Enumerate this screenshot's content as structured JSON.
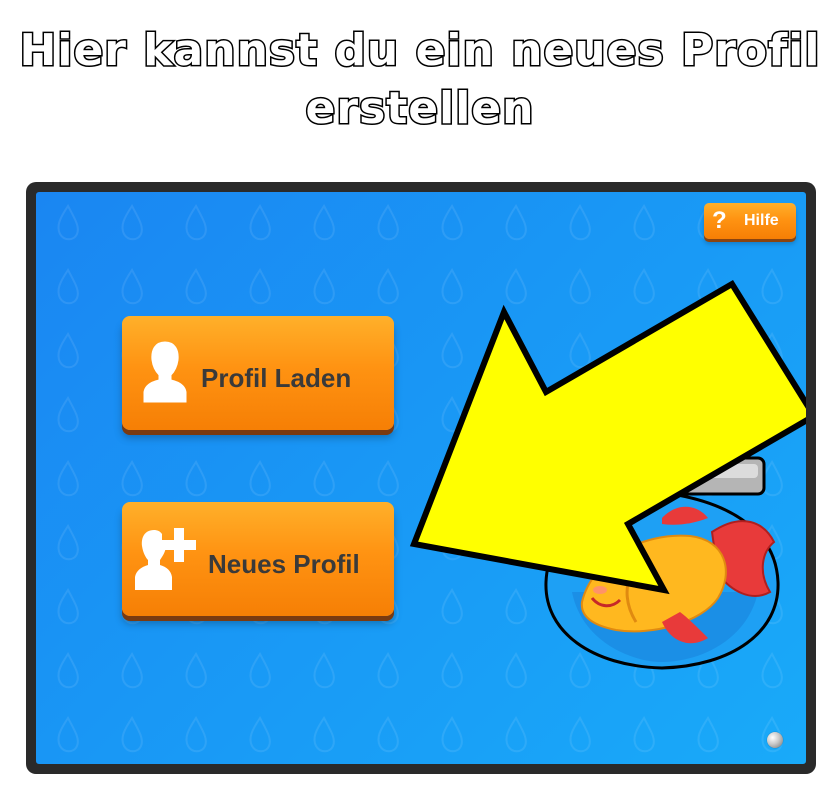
{
  "caption": {
    "line1": "Hier kannst du ein neues Profil",
    "line2": "erstellen"
  },
  "toolbar": {
    "help_icon": "?",
    "help_label": "Hilfe"
  },
  "menu": {
    "load_profile_label": "Profil Laden",
    "load_profile_icon": "person-silhouette-icon",
    "new_profile_label": "Neues Profil",
    "new_profile_icon": "person-add-icon"
  },
  "decor": {
    "mascot": "goldfish-in-bowl",
    "annotation": "yellow-arrow-pointing-at-new-profile"
  },
  "colors": {
    "background_blue": "#1997f5",
    "button_orange": "#ff9312",
    "arrow_yellow": "#ffff00",
    "frame_dark": "#2a2a2a"
  }
}
